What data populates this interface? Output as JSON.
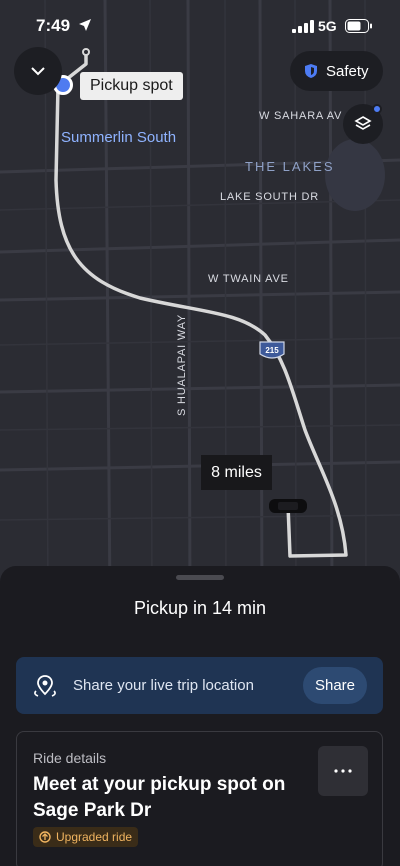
{
  "status_bar": {
    "time": "7:49",
    "network": "5G"
  },
  "map": {
    "pickup_label": "Pickup spot",
    "area_label": "Summerlin South",
    "lakes_label": "THE LAKES",
    "streets": {
      "sahara": "W SAHARA AV",
      "lake_south": "LAKE SOUTH DR",
      "twain": "W TWAIN AVE",
      "hualapai": "S HUALAPAI WAY"
    },
    "highway_shield": "215",
    "distance_label": "8 miles",
    "safety_label": "Safety",
    "colors": {
      "route": "#d8d8d8",
      "pickup_dot": "#4f7bf0"
    }
  },
  "sheet": {
    "eta_text": "Pickup in 14 min",
    "share": {
      "text": "Share your live trip location",
      "button": "Share"
    },
    "ride": {
      "label": "Ride details",
      "title": "Meet at your pickup spot on Sage Park Dr",
      "badge": "Upgraded ride"
    }
  }
}
